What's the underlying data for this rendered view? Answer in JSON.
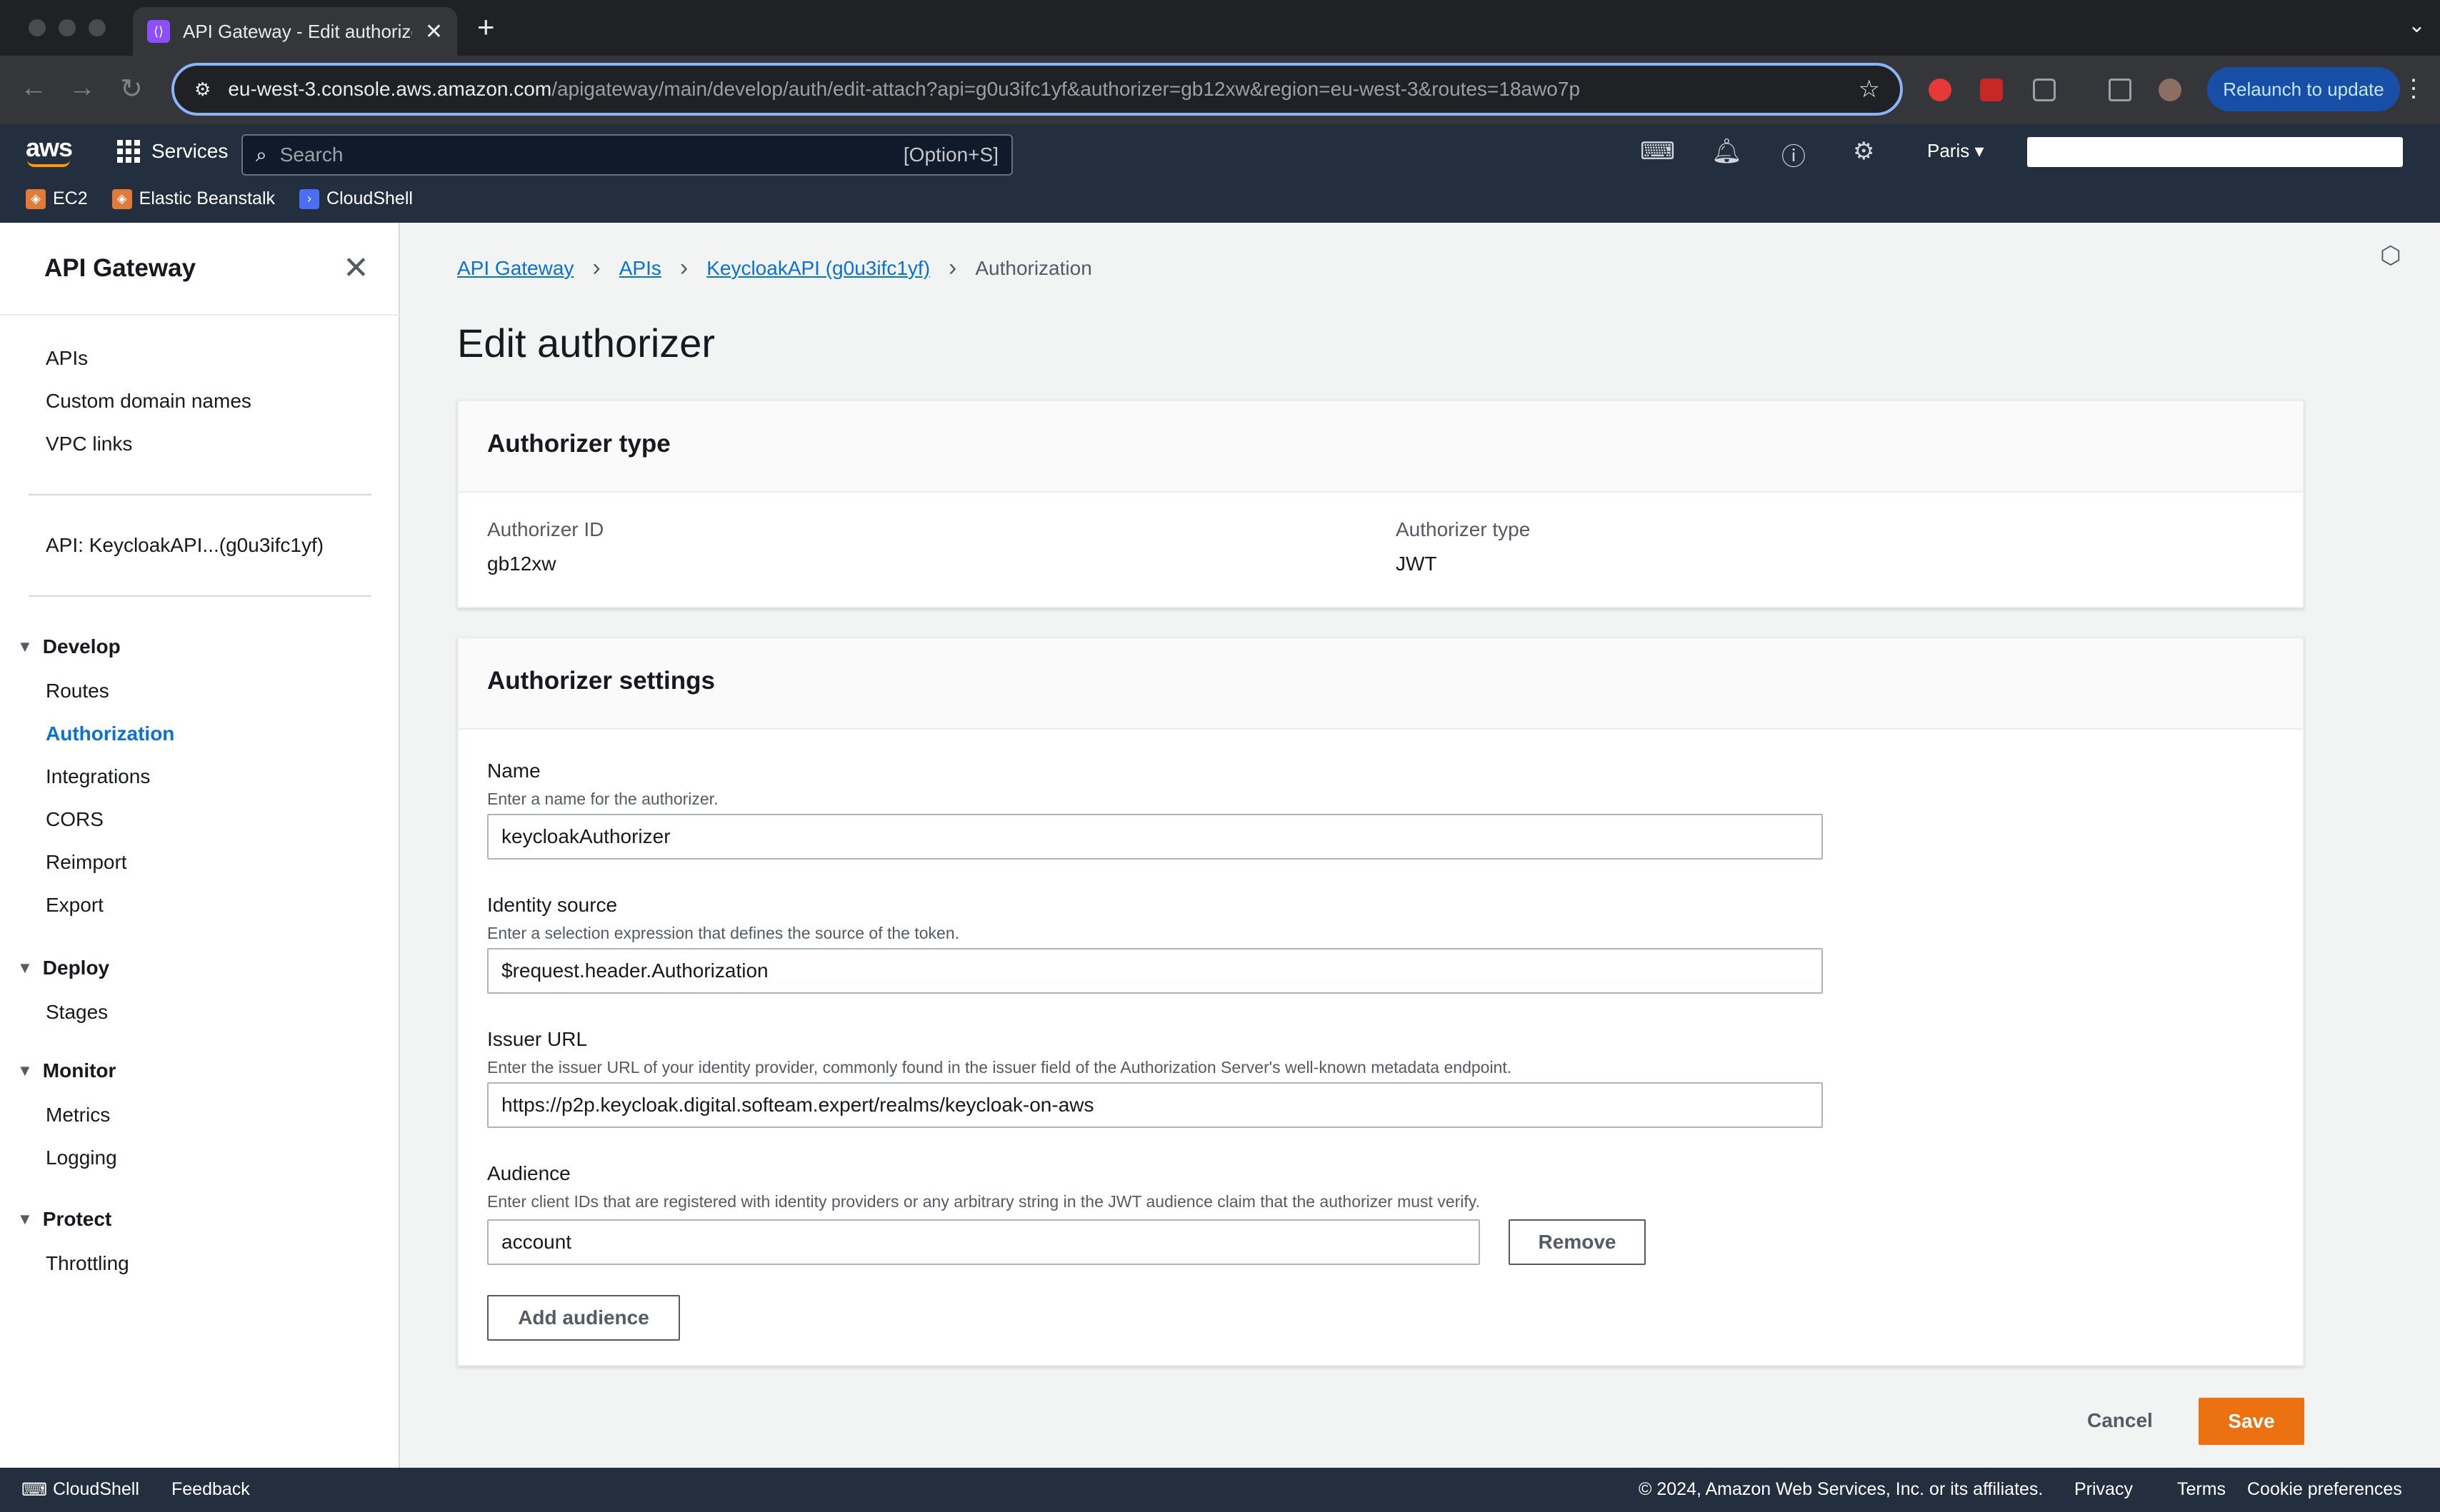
{
  "browser": {
    "tab_title": "API Gateway - Edit authorizer",
    "url_host": "eu-west-3.console.aws.amazon.com",
    "url_path": "/apigateway/main/develop/auth/edit-attach?api=g0u3ifc1yf&authorizer=gb12xw&region=eu-west-3&routes=18awo7p",
    "relaunch_label": "Relaunch to update"
  },
  "aws_nav": {
    "logo": "aws",
    "services_label": "Services",
    "search_placeholder": "Search",
    "search_shortcut": "[Option+S]",
    "region": "Paris ▾",
    "favorites": [
      {
        "label": "EC2",
        "color": "#e07b39"
      },
      {
        "label": "Elastic Beanstalk",
        "color": "#e07b39"
      },
      {
        "label": "CloudShell",
        "color": "#4a6ef5"
      }
    ]
  },
  "sidebar": {
    "title": "API Gateway",
    "top_links": [
      "APIs",
      "Custom domain names",
      "VPC links"
    ],
    "api_link": "API: KeycloakAPI...(g0u3ifc1yf)",
    "sections": [
      {
        "title": "Develop",
        "items": [
          "Routes",
          "Authorization",
          "Integrations",
          "CORS",
          "Reimport",
          "Export"
        ]
      },
      {
        "title": "Deploy",
        "items": [
          "Stages"
        ]
      },
      {
        "title": "Monitor",
        "items": [
          "Metrics",
          "Logging"
        ]
      },
      {
        "title": "Protect",
        "items": [
          "Throttling"
        ]
      }
    ]
  },
  "breadcrumb": [
    "API Gateway",
    "APIs",
    "KeycloakAPI (g0u3ifc1yf)",
    "Authorization"
  ],
  "page_title": "Edit authorizer",
  "authorizer_type_panel": {
    "heading": "Authorizer type",
    "id_label": "Authorizer ID",
    "id_value": "gb12xw",
    "type_label": "Authorizer type",
    "type_value": "JWT"
  },
  "settings_panel": {
    "heading": "Authorizer settings",
    "name": {
      "label": "Name",
      "desc": "Enter a name for the authorizer.",
      "value": "keycloakAuthorizer"
    },
    "identity": {
      "label": "Identity source",
      "desc": "Enter a selection expression that defines the source of the token.",
      "value": "$request.header.Authorization"
    },
    "issuer": {
      "label": "Issuer URL",
      "desc": "Enter the issuer URL of your identity provider, commonly found in the issuer field of the Authorization Server's well-known metadata endpoint.",
      "value": "https://p2p.keycloak.digital.softeam.expert/realms/keycloak-on-aws"
    },
    "audience": {
      "label": "Audience",
      "desc": "Enter client IDs that are registered with identity providers or any arbitrary string in the JWT audience claim that the authorizer must verify.",
      "value": "account",
      "remove_label": "Remove",
      "add_label": "Add audience"
    }
  },
  "actions": {
    "cancel": "Cancel",
    "save": "Save"
  },
  "footer": {
    "cloudshell": "CloudShell",
    "feedback": "Feedback",
    "copyright": "© 2024, Amazon Web Services, Inc. or its affiliates.",
    "privacy": "Privacy",
    "terms": "Terms",
    "cookies": "Cookie preferences"
  }
}
